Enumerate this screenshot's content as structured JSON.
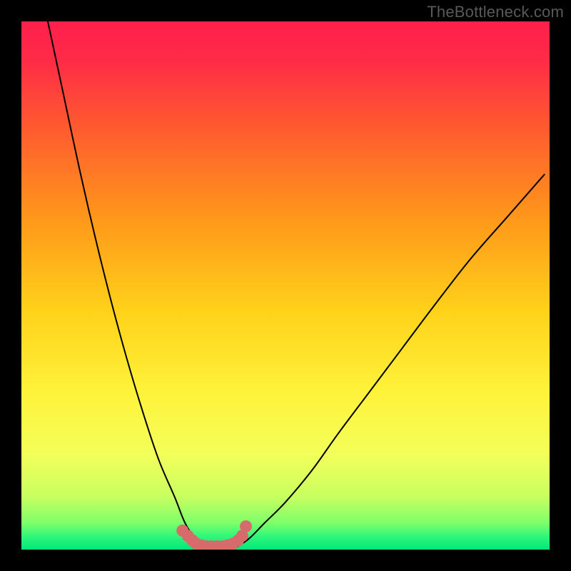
{
  "watermark": "TheBottleneck.com",
  "chart_data": {
    "type": "line",
    "title": "",
    "xlabel": "",
    "ylabel": "",
    "xlim": [
      0,
      100
    ],
    "ylim": [
      0,
      100
    ],
    "background_gradient": {
      "top": "#ff1f4b",
      "mid_upper": "#ff8a1a",
      "mid": "#ffe600",
      "mid_lower": "#f5ff66",
      "lower": "#8fff66",
      "bottom": "#00e67a"
    },
    "curve_note": "Two smooth black branches forming a V that meets near x≈35, y≈0; left branch from top-left corner, right branch rises toward upper-right edge ~y≈70.",
    "series": [
      {
        "name": "left_branch",
        "x": [
          5,
          8,
          11,
          14,
          17,
          20,
          23,
          26,
          29,
          31,
          33,
          35
        ],
        "y": [
          100,
          86,
          72,
          59,
          47,
          36,
          26,
          17,
          10,
          5,
          2,
          0
        ]
      },
      {
        "name": "right_branch",
        "x": [
          40,
          43,
          46,
          50,
          55,
          60,
          66,
          72,
          78,
          85,
          92,
          99
        ],
        "y": [
          0,
          2,
          5,
          9,
          15,
          22,
          30,
          38,
          46,
          55,
          63,
          71
        ]
      }
    ],
    "markers": {
      "name": "bottom_dots",
      "color": "#d76b6b",
      "x": [
        30.5,
        31.5,
        32.3,
        33.0,
        34.0,
        35.0,
        36.0,
        37.0,
        38.0,
        39.0,
        40.0,
        41.0,
        41.8,
        42.5
      ],
      "y": [
        3.6,
        2.6,
        1.8,
        1.2,
        0.8,
        0.6,
        0.6,
        0.6,
        0.6,
        0.8,
        1.1,
        1.7,
        2.6,
        4.4
      ]
    }
  }
}
